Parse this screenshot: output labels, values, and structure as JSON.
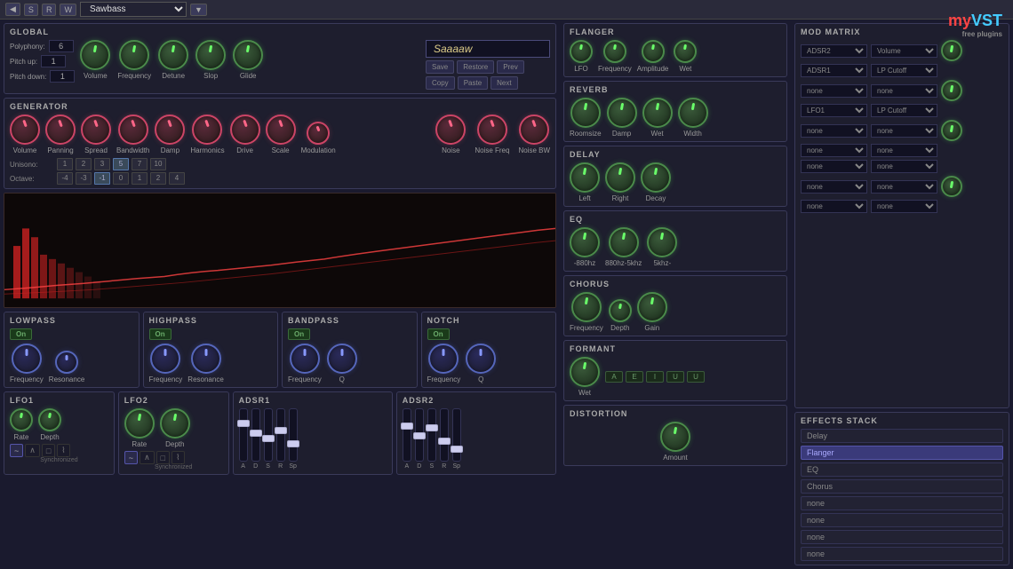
{
  "topbar": {
    "buttons": [
      "◀",
      "S",
      "R",
      "W"
    ],
    "preset_name": "Sawbass"
  },
  "global": {
    "title": "GLOBAL",
    "polyphony_label": "Polyphony:",
    "polyphony_value": "6",
    "pitch_up_label": "Pitch up:",
    "pitch_up_value": "1",
    "pitch_down_label": "Pitch down:",
    "pitch_down_value": "1",
    "knobs": [
      {
        "label": "Volume",
        "value": "45",
        "type": "green"
      },
      {
        "label": "Frequency",
        "value": "0",
        "type": "green"
      },
      {
        "label": "Detune",
        "value": "16",
        "type": "green"
      },
      {
        "label": "Slop",
        "value": "50",
        "type": "green"
      },
      {
        "label": "Glide",
        "value": "0",
        "type": "green"
      }
    ],
    "preset_name": "Saaaaw",
    "buttons": [
      "Save",
      "Restore",
      "Prev",
      "Copy",
      "Paste",
      "Next"
    ]
  },
  "generator": {
    "title": "GENERATOR",
    "knobs": [
      {
        "label": "Volume",
        "value": "48",
        "type": "pink"
      },
      {
        "label": "Panning",
        "value": "50",
        "type": "pink"
      },
      {
        "label": "Spread",
        "value": "48",
        "type": "pink"
      },
      {
        "label": "Bandwidth",
        "value": "47",
        "type": "pink"
      },
      {
        "label": "Damp",
        "value": "78",
        "type": "pink"
      },
      {
        "label": "Harmonics",
        "value": "54",
        "type": "pink"
      },
      {
        "label": "Drive",
        "value": "47",
        "type": "pink"
      },
      {
        "label": "Scale",
        "value": "8",
        "type": "pink"
      },
      {
        "label": "Modulation",
        "value": "3",
        "type": "pink"
      }
    ],
    "noise_knobs": [
      {
        "label": "Noise",
        "value": "0",
        "type": "pink"
      },
      {
        "label": "Noise Freq",
        "value": "50",
        "type": "pink"
      },
      {
        "label": "Noise BW",
        "value": "99",
        "type": "pink"
      }
    ],
    "unison_label": "Unisono:",
    "unison_values": [
      "1",
      "2",
      "3",
      "5",
      "7",
      "10"
    ],
    "octave_label": "Octave:",
    "octave_values": [
      "-4",
      "-3",
      "-1",
      "0",
      "1",
      "2",
      "4"
    ]
  },
  "flanger": {
    "title": "FLANGER",
    "knobs": [
      {
        "label": "LFO",
        "value": "20",
        "type": "green"
      },
      {
        "label": "Frequency",
        "value": "20",
        "type": "green"
      },
      {
        "label": "Amplitude",
        "value": "20",
        "type": "green"
      },
      {
        "label": "Wet",
        "value": "20",
        "type": "green"
      }
    ]
  },
  "reverb": {
    "title": "REVERB",
    "knobs": [
      {
        "label": "Roomsize",
        "value": "72",
        "type": "green"
      },
      {
        "label": "Damp",
        "value": "99",
        "type": "green"
      },
      {
        "label": "Wet",
        "value": "97",
        "type": "green"
      },
      {
        "label": "Width",
        "value": "99",
        "type": "green"
      }
    ]
  },
  "delay": {
    "title": "DELAY",
    "knobs": [
      {
        "label": "Left",
        "value": "70",
        "type": "green"
      },
      {
        "label": "Right",
        "value": "48",
        "type": "green"
      },
      {
        "label": "Decay",
        "value": "55",
        "type": "green"
      }
    ]
  },
  "eq": {
    "title": "EQ",
    "knobs": [
      {
        "label": "-880hz",
        "value": "49",
        "type": "green"
      },
      {
        "label": "880hz-5khz",
        "value": "50",
        "type": "green"
      },
      {
        "label": "5khz-",
        "value": "75",
        "type": "green"
      }
    ]
  },
  "chorus": {
    "title": "CHORUS",
    "knobs": [
      {
        "label": "Frequency",
        "value": "0",
        "type": "green"
      },
      {
        "label": "Depth",
        "value": "20",
        "type": "green"
      },
      {
        "label": "Gain",
        "value": "99",
        "type": "green"
      }
    ]
  },
  "formant": {
    "title": "FORMANT",
    "knob": {
      "label": "Wet",
      "value": "99",
      "type": "green"
    },
    "buttons": [
      "A",
      "E",
      "I",
      "U",
      "U"
    ]
  },
  "distortion": {
    "title": "DISTORTION",
    "knob": {
      "label": "Amount",
      "value": "36",
      "type": "green"
    }
  },
  "lowpass": {
    "title": "LOWPASS",
    "on_label": "On",
    "knobs": [
      {
        "label": "Frequency",
        "value": "75",
        "type": "blue"
      },
      {
        "label": "Resonance",
        "value": "0",
        "type": "blue"
      }
    ]
  },
  "highpass": {
    "title": "HIGHPASS",
    "on_label": "On",
    "knobs": [
      {
        "label": "Frequency",
        "value": "50",
        "type": "blue"
      },
      {
        "label": "Resonance",
        "value": "50",
        "type": "blue"
      }
    ]
  },
  "bandpass": {
    "title": "BANDPASS",
    "on_label": "On",
    "knobs": [
      {
        "label": "Frequency",
        "value": "50",
        "type": "blue"
      },
      {
        "label": "Q",
        "value": "50",
        "type": "blue"
      }
    ]
  },
  "notch": {
    "title": "NOTCH",
    "on_label": "On",
    "knobs": [
      {
        "label": "Frequency",
        "value": "50",
        "type": "blue"
      },
      {
        "label": "Q",
        "value": "50",
        "type": "blue"
      }
    ]
  },
  "lfo1": {
    "title": "LFO1",
    "knobs": [
      {
        "label": "Rate",
        "value": "17",
        "type": "green"
      },
      {
        "label": "Depth",
        "value": "24",
        "type": "green"
      }
    ],
    "waves": [
      "~",
      "∧",
      "□",
      "⌇"
    ],
    "sync_label": "Synchronized"
  },
  "lfo2": {
    "title": "LFO2",
    "knobs": [
      {
        "label": "Rate",
        "value": "50",
        "type": "green"
      },
      {
        "label": "Depth",
        "value": "50",
        "type": "green"
      }
    ],
    "waves": [
      "~",
      "∧",
      "□",
      "⌇"
    ],
    "sync_label": "Synchronized"
  },
  "adsr1": {
    "title": "ADSR1",
    "faders": [
      {
        "label": "A",
        "position": 70
      },
      {
        "label": "D",
        "position": 40
      },
      {
        "label": "S",
        "position": 50
      },
      {
        "label": "R",
        "position": 60
      },
      {
        "label": "Sp",
        "position": 80
      }
    ]
  },
  "adsr2": {
    "title": "ADSR2",
    "faders": [
      {
        "label": "A",
        "position": 65
      },
      {
        "label": "D",
        "position": 45
      },
      {
        "label": "S",
        "position": 55
      },
      {
        "label": "R",
        "position": 50
      },
      {
        "label": "Sp",
        "position": 75
      }
    ]
  },
  "mod_matrix": {
    "title": "MOD MATRIX",
    "rows": [
      {
        "source": "ADSR2",
        "dest": "Volume"
      },
      {
        "source": "ADSR1",
        "dest": "LP Cutoff"
      },
      {
        "source": "none",
        "dest": "none"
      },
      {
        "source": "LFO1",
        "dest": "LP Cutoff"
      },
      {
        "source": "none",
        "dest": "none"
      },
      {
        "source": "none",
        "dest": "none"
      },
      {
        "source": "none",
        "dest": "none"
      },
      {
        "source": "none",
        "dest": "none"
      },
      {
        "source": "none",
        "dest": "none"
      }
    ]
  },
  "effects_stack": {
    "title": "EFFECTS STACK",
    "items": [
      {
        "label": "Delay",
        "active": false
      },
      {
        "label": "Flanger",
        "active": true
      },
      {
        "label": "EQ",
        "active": false
      },
      {
        "label": "Chorus",
        "active": false
      },
      {
        "label": "none",
        "active": false
      },
      {
        "label": "none",
        "active": false
      },
      {
        "label": "none",
        "active": false
      },
      {
        "label": "none",
        "active": false
      }
    ]
  },
  "myvst": {
    "my": "my",
    "vst": "VST",
    "sub": "free plugins"
  }
}
